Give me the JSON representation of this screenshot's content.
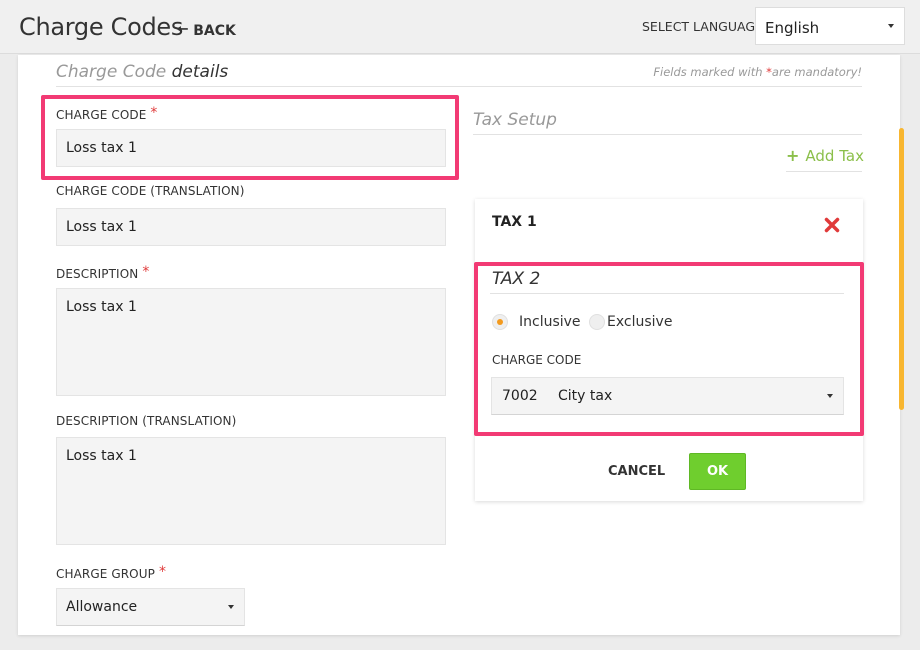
{
  "header": {
    "title": "Charge Codes",
    "back_label": "BACK",
    "language_label": "SELECT LANGUAGE",
    "language_value": "English"
  },
  "details": {
    "title_part1": "Charge Code",
    "title_part2": "details",
    "mandatory_note_before": "Fields marked with",
    "mandatory_star": "*",
    "mandatory_note_after": "are mandatory!"
  },
  "form": {
    "charge_code_label": "CHARGE CODE",
    "charge_code_value": "Loss tax 1",
    "charge_code_translation_label": "CHARGE CODE (TRANSLATION)",
    "charge_code_translation_value": "Loss tax 1",
    "description_label": "DESCRIPTION",
    "description_value": "Loss tax 1",
    "description_translation_label": "DESCRIPTION (TRANSLATION)",
    "description_translation_value": "Loss tax 1",
    "charge_group_label": "CHARGE GROUP",
    "charge_group_value": "Allowance",
    "required_star": "*"
  },
  "tax_setup": {
    "title": "Tax Setup",
    "add_tax_label": "Add Tax",
    "add_tax_icon": "+",
    "tax1_label": "TAX 1",
    "tax2_label": "TAX 2",
    "inclusive_label": "Inclusive",
    "exclusive_label": "Exclusive",
    "selected_type": "Inclusive",
    "charge_code_label": "CHARGE CODE",
    "charge_code_number": "7002",
    "charge_code_name": "City tax",
    "cancel_label": "CANCEL",
    "ok_label": "OK"
  },
  "icons": {
    "back": "arrow-left-icon",
    "remove": "remove-x-icon",
    "add": "plus-icon",
    "dropdown": "caret-down-icon"
  },
  "colors": {
    "accent_green": "#6fce2e",
    "add_tax_green": "#8bbf4a",
    "highlight_pink": "#f23a74",
    "required_red": "#e03a3a",
    "radio_orange": "#f39a1e",
    "scrollbar_orange": "#f8b630"
  }
}
